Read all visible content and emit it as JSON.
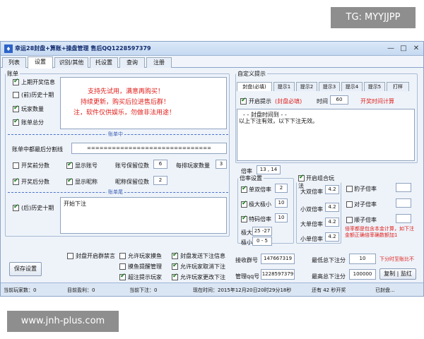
{
  "watermarks": {
    "top": "TG: MYYJJPP",
    "bottom": "www.jnh-plus.com"
  },
  "window": {
    "title": "幸运28封盘+算账+操盘管理 售后QQ1228597379",
    "minimize": "—",
    "maximize": "□",
    "close": "✕"
  },
  "tabs": [
    "列表",
    "设置",
    "识别/其他",
    "托设置",
    "查询",
    "注册"
  ],
  "ledger": {
    "legend": "账单",
    "opt_last_open_info": "上期开奖信息",
    "opt_prev_ten_history": "(前)历史十期",
    "opt_player_count": "玩家数量",
    "opt_settle_total": "账单总分",
    "notice": [
      "支持先试用，满意再购买！",
      "持续更新，购买后拉进售后群！",
      "注，软件仅供娱乐，勿做非法用途！"
    ],
    "divider_mid": "账单中",
    "min_score_label": "账单中都最后分割线",
    "min_score_value": "==============================",
    "opt_open_before_score": "开奖前分数",
    "opt_show_account": "显示账号",
    "account_keep_label": "账号保留位数",
    "account_keep_value": "6",
    "per_row_label": "每排玩家数量",
    "per_row_value": "3",
    "opt_open_after_score": "开奖后分数",
    "opt_show_nickname": "显示昵称",
    "nickname_keep_label": "昵称保留位数",
    "nickname_keep_value": "2",
    "divider_tail": "账单尾",
    "opt_after_ten_history": "(后)历史十期",
    "tail_text": "开始下注"
  },
  "custom_prompt": {
    "legend": "自定义提示",
    "tabs": [
      "封盘(必填)",
      "提示1",
      "提示2",
      "提示3",
      "提示4",
      "提示5",
      "打样"
    ],
    "opt_enable": "开启提示",
    "required_note": "(封盘必填)",
    "time_label": "时间",
    "time_value": "60",
    "time_note": "开奖时间计算",
    "content_lines": [
      "- - 封盘时间到 - -",
      "以上下注有效，以下下注无效。"
    ]
  },
  "multiplier": {
    "label": "倍率",
    "value": "13 , 14",
    "settings_legend": "倍率设置",
    "opt_single_double": "单双倍率",
    "single_double_value": "2",
    "opt_big_small": "极大极小",
    "big_small_value": "10",
    "opt_special_code": "特码倍率",
    "special_code_value": "10",
    "max_label": "极大",
    "max_range": "25 -27",
    "min_label": "极小",
    "min_range": "0 - 5",
    "combo_legend": "开启组合玩法",
    "big_double_label": "大双倍率",
    "big_double_value": "4.2",
    "small_double_label": "小双倍率",
    "small_double_value": "4.2",
    "big_single_label": "大单倍率",
    "big_single_value": "4.2",
    "small_single_label": "小单倍率",
    "small_single_value": "4.2",
    "leopard_label": "豹子倍率",
    "pair_label": "对子倍率",
    "straight_label": "顺子倍率",
    "combo_note": "倍率都是包含本金计算，如下注金额正确倍率确数额加1"
  },
  "bottom_opts": {
    "opt_open_group_ban": "封盘开启群禁言",
    "opt_allow_player_bet": "允许玩家摸鱼",
    "opt_show_remaining": "封盘发送下注信息",
    "opt_bet_reminder": "摸鱼提醒管理",
    "opt_allow_cancel": "允许玩家取消下注",
    "opt_cancel_hint": "超注提示玩家",
    "opt_allow_change": "允许玩家更改下注"
  },
  "bottom_fields": {
    "group_label": "接收群号",
    "group_value": "147667319",
    "manager_label": "管理qq号",
    "manager_value": "1228597379",
    "min_bet_label": "最低总下注分",
    "min_bet_value": "10",
    "max_bet_label": "最高总下注分",
    "max_bet_value": "100000",
    "red_note": "下分时至账比不",
    "save_btn": "保存设置",
    "copy_btn": "复制",
    "sep": "|",
    "watch_btn": "监红"
  },
  "statusbar": {
    "players": "当前玩家数：0",
    "profit": "目前盈利：0",
    "total_bets": "当前下注：0",
    "time": "现在时间：2015年12月20日20时29分18秒",
    "open_info": "还有 42 秒开奖",
    "state": "已封盘..."
  }
}
